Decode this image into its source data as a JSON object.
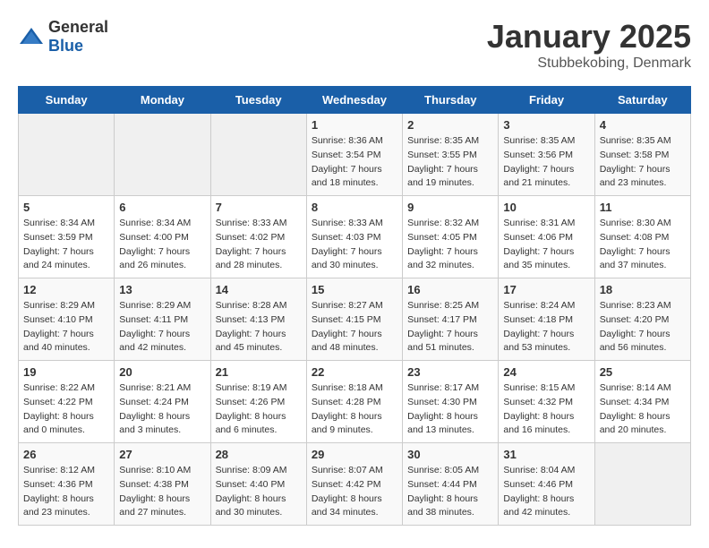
{
  "header": {
    "logo_general": "General",
    "logo_blue": "Blue",
    "title": "January 2025",
    "subtitle": "Stubbekobing, Denmark"
  },
  "days_of_week": [
    "Sunday",
    "Monday",
    "Tuesday",
    "Wednesday",
    "Thursday",
    "Friday",
    "Saturday"
  ],
  "weeks": [
    [
      {
        "day": "",
        "info": ""
      },
      {
        "day": "",
        "info": ""
      },
      {
        "day": "",
        "info": ""
      },
      {
        "day": "1",
        "info": "Sunrise: 8:36 AM\nSunset: 3:54 PM\nDaylight: 7 hours\nand 18 minutes."
      },
      {
        "day": "2",
        "info": "Sunrise: 8:35 AM\nSunset: 3:55 PM\nDaylight: 7 hours\nand 19 minutes."
      },
      {
        "day": "3",
        "info": "Sunrise: 8:35 AM\nSunset: 3:56 PM\nDaylight: 7 hours\nand 21 minutes."
      },
      {
        "day": "4",
        "info": "Sunrise: 8:35 AM\nSunset: 3:58 PM\nDaylight: 7 hours\nand 23 minutes."
      }
    ],
    [
      {
        "day": "5",
        "info": "Sunrise: 8:34 AM\nSunset: 3:59 PM\nDaylight: 7 hours\nand 24 minutes."
      },
      {
        "day": "6",
        "info": "Sunrise: 8:34 AM\nSunset: 4:00 PM\nDaylight: 7 hours\nand 26 minutes."
      },
      {
        "day": "7",
        "info": "Sunrise: 8:33 AM\nSunset: 4:02 PM\nDaylight: 7 hours\nand 28 minutes."
      },
      {
        "day": "8",
        "info": "Sunrise: 8:33 AM\nSunset: 4:03 PM\nDaylight: 7 hours\nand 30 minutes."
      },
      {
        "day": "9",
        "info": "Sunrise: 8:32 AM\nSunset: 4:05 PM\nDaylight: 7 hours\nand 32 minutes."
      },
      {
        "day": "10",
        "info": "Sunrise: 8:31 AM\nSunset: 4:06 PM\nDaylight: 7 hours\nand 35 minutes."
      },
      {
        "day": "11",
        "info": "Sunrise: 8:30 AM\nSunset: 4:08 PM\nDaylight: 7 hours\nand 37 minutes."
      }
    ],
    [
      {
        "day": "12",
        "info": "Sunrise: 8:29 AM\nSunset: 4:10 PM\nDaylight: 7 hours\nand 40 minutes."
      },
      {
        "day": "13",
        "info": "Sunrise: 8:29 AM\nSunset: 4:11 PM\nDaylight: 7 hours\nand 42 minutes."
      },
      {
        "day": "14",
        "info": "Sunrise: 8:28 AM\nSunset: 4:13 PM\nDaylight: 7 hours\nand 45 minutes."
      },
      {
        "day": "15",
        "info": "Sunrise: 8:27 AM\nSunset: 4:15 PM\nDaylight: 7 hours\nand 48 minutes."
      },
      {
        "day": "16",
        "info": "Sunrise: 8:25 AM\nSunset: 4:17 PM\nDaylight: 7 hours\nand 51 minutes."
      },
      {
        "day": "17",
        "info": "Sunrise: 8:24 AM\nSunset: 4:18 PM\nDaylight: 7 hours\nand 53 minutes."
      },
      {
        "day": "18",
        "info": "Sunrise: 8:23 AM\nSunset: 4:20 PM\nDaylight: 7 hours\nand 56 minutes."
      }
    ],
    [
      {
        "day": "19",
        "info": "Sunrise: 8:22 AM\nSunset: 4:22 PM\nDaylight: 8 hours\nand 0 minutes."
      },
      {
        "day": "20",
        "info": "Sunrise: 8:21 AM\nSunset: 4:24 PM\nDaylight: 8 hours\nand 3 minutes."
      },
      {
        "day": "21",
        "info": "Sunrise: 8:19 AM\nSunset: 4:26 PM\nDaylight: 8 hours\nand 6 minutes."
      },
      {
        "day": "22",
        "info": "Sunrise: 8:18 AM\nSunset: 4:28 PM\nDaylight: 8 hours\nand 9 minutes."
      },
      {
        "day": "23",
        "info": "Sunrise: 8:17 AM\nSunset: 4:30 PM\nDaylight: 8 hours\nand 13 minutes."
      },
      {
        "day": "24",
        "info": "Sunrise: 8:15 AM\nSunset: 4:32 PM\nDaylight: 8 hours\nand 16 minutes."
      },
      {
        "day": "25",
        "info": "Sunrise: 8:14 AM\nSunset: 4:34 PM\nDaylight: 8 hours\nand 20 minutes."
      }
    ],
    [
      {
        "day": "26",
        "info": "Sunrise: 8:12 AM\nSunset: 4:36 PM\nDaylight: 8 hours\nand 23 minutes."
      },
      {
        "day": "27",
        "info": "Sunrise: 8:10 AM\nSunset: 4:38 PM\nDaylight: 8 hours\nand 27 minutes."
      },
      {
        "day": "28",
        "info": "Sunrise: 8:09 AM\nSunset: 4:40 PM\nDaylight: 8 hours\nand 30 minutes."
      },
      {
        "day": "29",
        "info": "Sunrise: 8:07 AM\nSunset: 4:42 PM\nDaylight: 8 hours\nand 34 minutes."
      },
      {
        "day": "30",
        "info": "Sunrise: 8:05 AM\nSunset: 4:44 PM\nDaylight: 8 hours\nand 38 minutes."
      },
      {
        "day": "31",
        "info": "Sunrise: 8:04 AM\nSunset: 4:46 PM\nDaylight: 8 hours\nand 42 minutes."
      },
      {
        "day": "",
        "info": ""
      }
    ]
  ]
}
